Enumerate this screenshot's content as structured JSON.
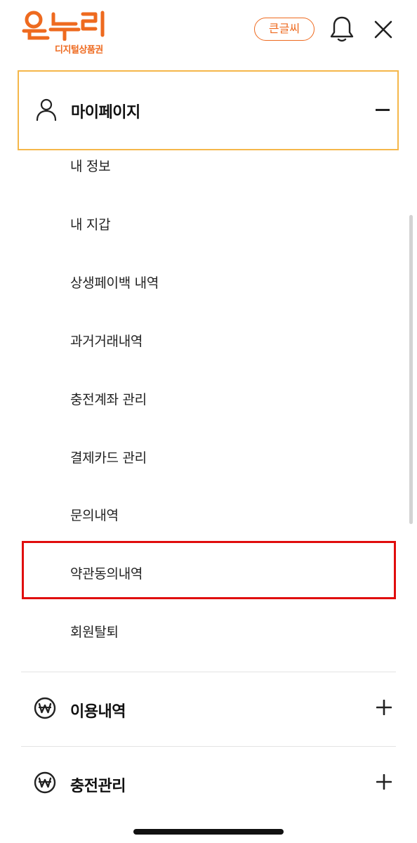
{
  "header": {
    "logo_main": "온누리",
    "logo_sub": "디지털상품권",
    "large_text_button": "큰글씨"
  },
  "menu": {
    "mypage": {
      "title": "마이페이지",
      "items": [
        "내 정보",
        "내 지갑",
        "상생페이백 내역",
        "과거거래내역",
        "충전계좌 관리",
        "결제카드 관리",
        "문의내역",
        "약관동의내역",
        "회원탈퇴"
      ]
    },
    "usage": {
      "title": "이용내역"
    },
    "charge": {
      "title": "충전관리"
    }
  },
  "colors": {
    "brand": "#ee6a1f",
    "expanded_border": "#f5b74a",
    "highlight": "#e00d0d"
  }
}
